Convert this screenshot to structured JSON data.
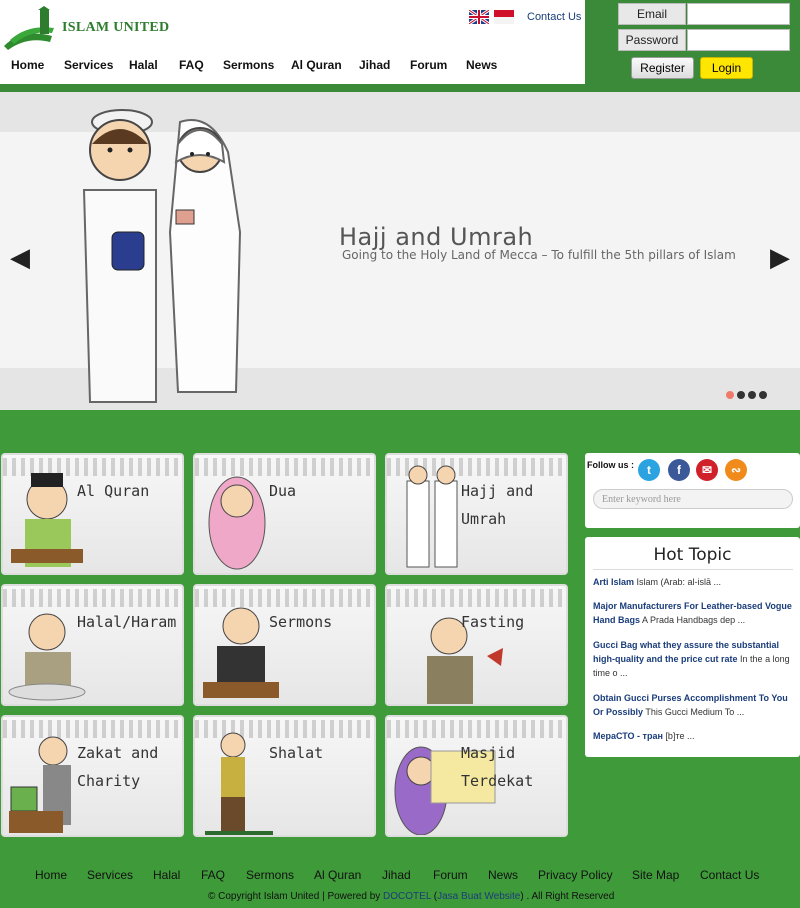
{
  "brand": {
    "name": "ISLAM UNITED"
  },
  "header": {
    "contact": "Contact Us",
    "flags": [
      "uk-flag",
      "indonesia-flag"
    ]
  },
  "nav": [
    "Home",
    "Services",
    "Halal",
    "FAQ",
    "Sermons",
    "Al Quran",
    "Jihad",
    "Forum",
    "News"
  ],
  "login": {
    "email_label": "Email",
    "password_label": "Password",
    "register": "Register",
    "login": "Login"
  },
  "slider": {
    "title": "Hajj and Umrah",
    "subtitle": "Going to the Holy Land of Mecca – To fulfill the 5th pillars of Islam",
    "slide_count": 4,
    "active_slide": 1
  },
  "tiles": [
    {
      "lines": [
        "Al Quran"
      ]
    },
    {
      "lines": [
        "Dua"
      ]
    },
    {
      "lines": [
        "Hajj and",
        "Umrah"
      ]
    },
    {
      "lines": [
        "Halal/Haram"
      ]
    },
    {
      "lines": [
        "Sermons"
      ]
    },
    {
      "lines": [
        "Fasting"
      ]
    },
    {
      "lines": [
        "Zakat and",
        "Charity"
      ]
    },
    {
      "lines": [
        "Shalat"
      ]
    },
    {
      "lines": [
        "Masjid",
        "Terdekat"
      ]
    }
  ],
  "follow": {
    "label": "Follow us :",
    "icons": [
      "twitter-icon",
      "facebook-icon",
      "email-icon",
      "rss-icon"
    ],
    "search_placeholder": "Enter keyword here"
  },
  "hot_topic": {
    "title": "Hot Topic",
    "items": [
      {
        "title": "Arti Islam",
        "snippet": "Islam (Arab: al-islā ..."
      },
      {
        "title": "Major Manufacturers For Leather-based Vogue Hand Bags",
        "snippet": "A Prada Handbags dep ..."
      },
      {
        "title": "Gucci Bag what they assure the substantial high-quality and the price cut rate",
        "snippet": "In the a long time o ..."
      },
      {
        "title": "Obtain Gucci Purses Accomplishment To You Or Possibly",
        "snippet": "This Gucci Medium To ..."
      },
      {
        "title": "МераСТО - тран",
        "snippet": "[b]те ..."
      }
    ]
  },
  "footer": {
    "nav": [
      "Home",
      "Services",
      "Halal",
      "FAQ",
      "Sermons",
      "Al Quran",
      "Jihad",
      "Forum",
      "News",
      "Privacy Policy",
      "Site Map",
      "Contact Us"
    ],
    "copy_prefix": "© Copyright Islam United | Powered by",
    "powered": "DOCOTEL",
    "jasa": "Jasa Buat Website",
    "copy_suffix": ". All Right Reserved"
  },
  "colors": {
    "green": "#3f9a3a",
    "dark_green": "#3a8a3a",
    "login_yellow": "#ffe600",
    "link_blue": "#1a3d7a"
  }
}
